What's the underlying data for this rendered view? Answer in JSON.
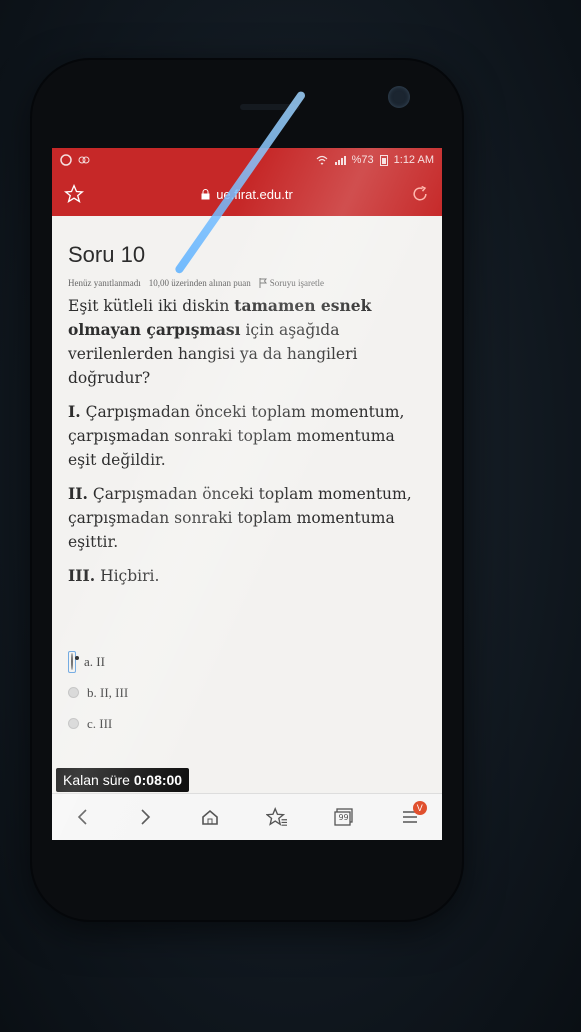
{
  "status": {
    "battery": "%73",
    "time": "1:12 AM"
  },
  "browser": {
    "url": "ue.firat.edu.tr"
  },
  "question": {
    "title": "Soru 10",
    "status": "Henüz yanıtlanmadı",
    "points": "10,00 üzerinden alınan puan",
    "flag_label": "Soruyu işaretle",
    "intro_1": "Eşit kütleli iki diskin ",
    "intro_bold": "tamamen esnek olmayan çarpışması",
    "intro_2": " için aşağıda verilenlerden hangisi ya da hangileri doğrudur?",
    "stmt1_num": "I.",
    "stmt1_text": " Çarpışmadan önceki toplam momentum, çarpışmadan sonraki toplam momentuma eşit değildir.",
    "stmt2_num": "II.",
    "stmt2_text": " Çarpışmadan önceki toplam momentum, çarpışmadan sonraki toplam momentuma eşittir.",
    "stmt3_num": "III.",
    "stmt3_text": " Hiçbiri."
  },
  "options": [
    {
      "label": "a. II",
      "selected": true
    },
    {
      "label": "b. II, III",
      "selected": false
    },
    {
      "label": "c. III",
      "selected": false
    }
  ],
  "timer": {
    "label": "Kalan süre ",
    "value": "0:08:00"
  },
  "nav": {
    "tabs_count": "99",
    "badge": "V"
  },
  "colors": {
    "browser_bar": "#c62828",
    "timer_bg": "#111111"
  }
}
